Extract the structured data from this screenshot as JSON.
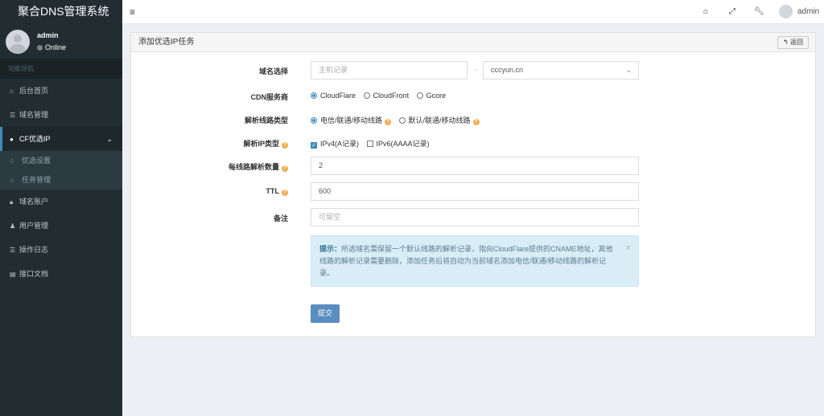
{
  "app": {
    "title": "聚合DNS管理系统"
  },
  "user": {
    "name": "admin",
    "status": "Online"
  },
  "sidebar": {
    "nav_header": "功能导航",
    "items": [
      {
        "label": "后台首页",
        "icon": "home-icon"
      },
      {
        "label": "域名管理",
        "icon": "list-icon"
      },
      {
        "label": "CF优选IP",
        "icon": "globe-icon"
      },
      {
        "label": "域名账户",
        "icon": "lock-icon"
      },
      {
        "label": "用户管理",
        "icon": "user-icon"
      },
      {
        "label": "操作日志",
        "icon": "list-icon"
      },
      {
        "label": "接口文档",
        "icon": "book-icon"
      }
    ],
    "sub_items": [
      {
        "label": "优选设置"
      },
      {
        "label": "任务管理"
      }
    ]
  },
  "header": {
    "username": "admin"
  },
  "panel": {
    "title": "添加优选IP任务",
    "back_label": "返回"
  },
  "form": {
    "domain": {
      "label": "域名选择",
      "host_placeholder": "主机记录",
      "separator": ".",
      "selected_domain": "cccyun.cn"
    },
    "cdn": {
      "label": "CDN服务商",
      "options": [
        "CloudFlare",
        "CloudFront",
        "Gcore"
      ],
      "selected": "CloudFlare"
    },
    "line_type": {
      "label": "解析线路类型",
      "options": [
        "电信/联通/移动线路",
        "默认/联通/移动线路"
      ],
      "selected": "电信/联通/移动线路"
    },
    "ip_type": {
      "label": "解析IP类型",
      "options": [
        "IPv4(A记录)",
        "IPv6(AAAA记录)"
      ],
      "checked": [
        "IPv4(A记录)"
      ]
    },
    "count": {
      "label": "每线路解析数量",
      "value": "2"
    },
    "ttl": {
      "label": "TTL",
      "value": "600"
    },
    "remark": {
      "label": "备注",
      "placeholder": "可留空"
    },
    "tip": {
      "title": "提示：",
      "text": "所选域名需保留一个默认线路的解析记录，指向CloudFlare提供的CNAME地址，其他线路的解析记录需要删除，添加任务后将自动为当前域名添加电信/联通/移动线路的解析记录。"
    },
    "submit_label": "提交"
  },
  "colors": {
    "sidebar": "#222d32",
    "accent": "#3c8dbc",
    "warning": "#f0ad4e",
    "alert_bg": "#d9edf7"
  }
}
